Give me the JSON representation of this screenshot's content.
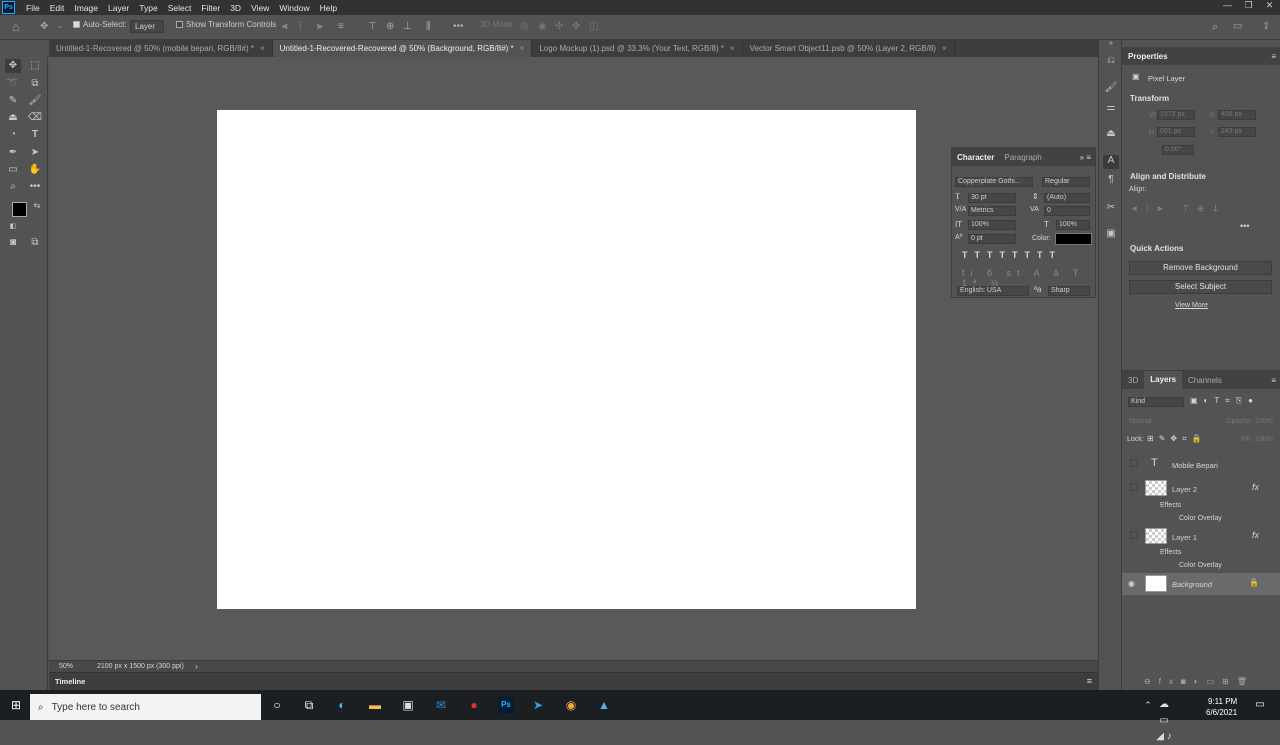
{
  "app": {
    "logo": "Ps"
  },
  "menu": [
    "File",
    "Edit",
    "Image",
    "Layer",
    "Type",
    "Select",
    "Filter",
    "3D",
    "View",
    "Window",
    "Help"
  ],
  "options": {
    "auto_select": "Auto-Select:",
    "layer_select": "Layer",
    "show_transform": "Show Transform Controls",
    "mode_3d": "3D Mode:"
  },
  "tabs": [
    {
      "label": "Untitled-1-Recovered @ 50% (mobile bepari, RGB/8#) *"
    },
    {
      "label": "Untitled-1-Recovered-Recovered @ 50% (Background, RGB/8#) *"
    },
    {
      "label": "Logo Mockup (1).psd @ 33.3% (Your Text, RGB/8) *"
    },
    {
      "label": "Vector Smart Object11.psb @ 50% (Layer 2, RGB/8)"
    }
  ],
  "status": {
    "zoom": "50%",
    "doc_size": "2100 px x 1500 px (300 ppi)"
  },
  "timeline": "Timeline",
  "character": {
    "tab1": "Character",
    "tab2": "Paragraph",
    "font": "Copperplate Gothi...",
    "style": "Regular",
    "size": "30 pt",
    "leading": "(Auto)",
    "kerning": "Metrics",
    "tracking": "0",
    "vscale": "100%",
    "hscale": "100%",
    "baseline": "0 pt",
    "color_label": "Color:",
    "language": "English: USA",
    "aa": "Sharp",
    "color": "#000000"
  },
  "properties": {
    "title": "Properties",
    "kind": "Pixel Layer",
    "transform": "Transform",
    "w": "W",
    "w_val": "1579 px",
    "x": "X",
    "x_val": "466 px",
    "h": "H",
    "h_val": "661 px",
    "y": "Y",
    "y_val": "243 px",
    "angle": "0.00°",
    "align": "Align and Distribute",
    "align_label": "Align:",
    "quick": "Quick Actions",
    "remove_bg": "Remove Background",
    "select_subject": "Select Subject",
    "view_more": "View More"
  },
  "layers_panel": {
    "tabs": [
      "3D",
      "Layers",
      "Channels"
    ],
    "kind": "Kind",
    "blend": "Normal",
    "opacity_label": "Opacity:",
    "opacity": "100%",
    "lock_label": "Lock:",
    "fill_label": "Fill:",
    "fill": "100%",
    "layers": [
      {
        "name": "Mobile Bepari"
      },
      {
        "name": "Layer 2",
        "effects": "Effects",
        "effect": "Color Overlay"
      },
      {
        "name": "Layer 1",
        "effects": "Effects",
        "effect": "Color Overlay"
      },
      {
        "name": "Background"
      }
    ]
  },
  "taskbar": {
    "search": "Type here to search",
    "time": "9:11 PM",
    "date": "6/6/2021"
  },
  "colors": {
    "foreground": "#000000",
    "background": "#ffffff",
    "accent": "#31a8ff"
  }
}
